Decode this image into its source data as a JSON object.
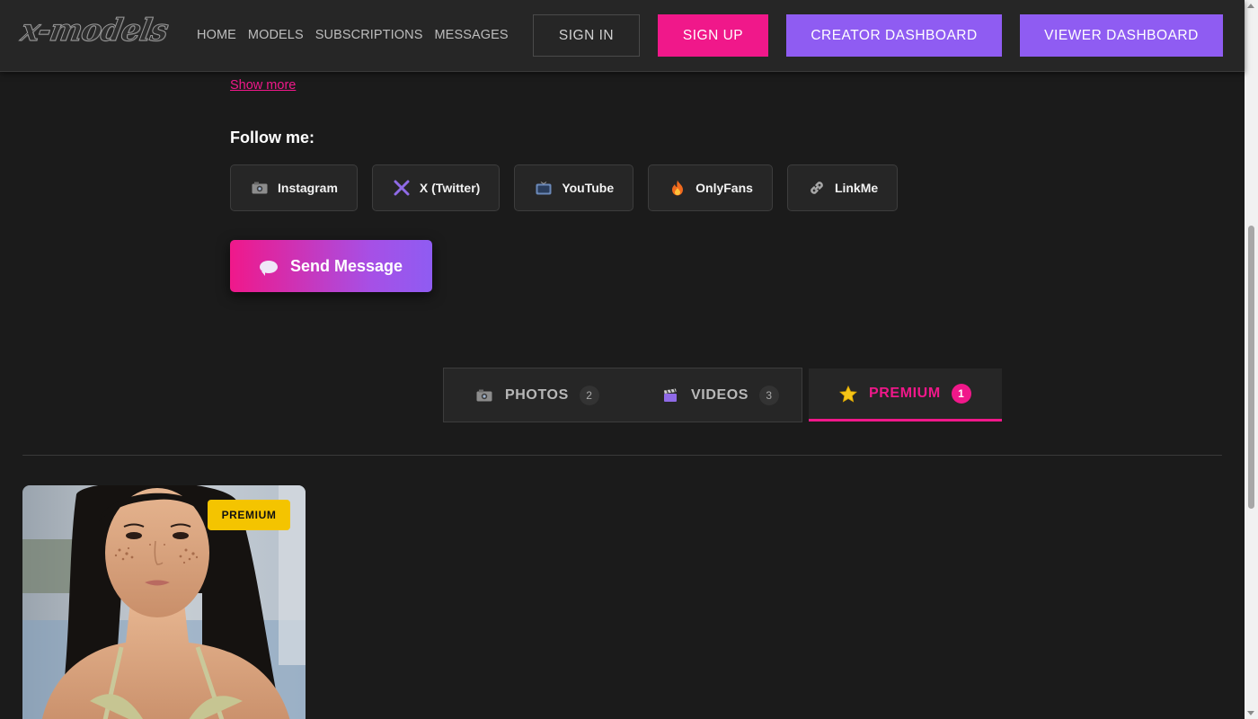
{
  "header": {
    "logo": "x-models",
    "nav": [
      "HOME",
      "MODELS",
      "SUBSCRIPTIONS",
      "MESSAGES"
    ],
    "sign_in": "SIGN IN",
    "sign_up": "SIGN UP",
    "creator_dashboard": "CREATOR DASHBOARD",
    "viewer_dashboard": "VIEWER DASHBOARD"
  },
  "profile": {
    "show_more": "Show more",
    "follow_title": "Follow me:",
    "socials": [
      {
        "label": "Instagram",
        "icon": "camera-icon"
      },
      {
        "label": "X (Twitter)",
        "icon": "x-icon"
      },
      {
        "label": "YouTube",
        "icon": "tv-icon"
      },
      {
        "label": "OnlyFans",
        "icon": "fire-icon"
      },
      {
        "label": "LinkMe",
        "icon": "link-icon"
      }
    ],
    "send_message": "Send Message"
  },
  "tabs": [
    {
      "label": "PHOTOS",
      "count": "2",
      "icon": "camera-icon"
    },
    {
      "label": "VIDEOS",
      "count": "3",
      "icon": "clapper-icon"
    },
    {
      "label": "PREMIUM",
      "count": "1",
      "icon": "star-icon",
      "active": true
    }
  ],
  "content": {
    "card_badge": "PREMIUM"
  },
  "colors": {
    "accent_pink": "#f0188a",
    "accent_purple": "#8f5cf2",
    "badge_yellow": "#f4c400",
    "background": "#1b1b1b"
  }
}
